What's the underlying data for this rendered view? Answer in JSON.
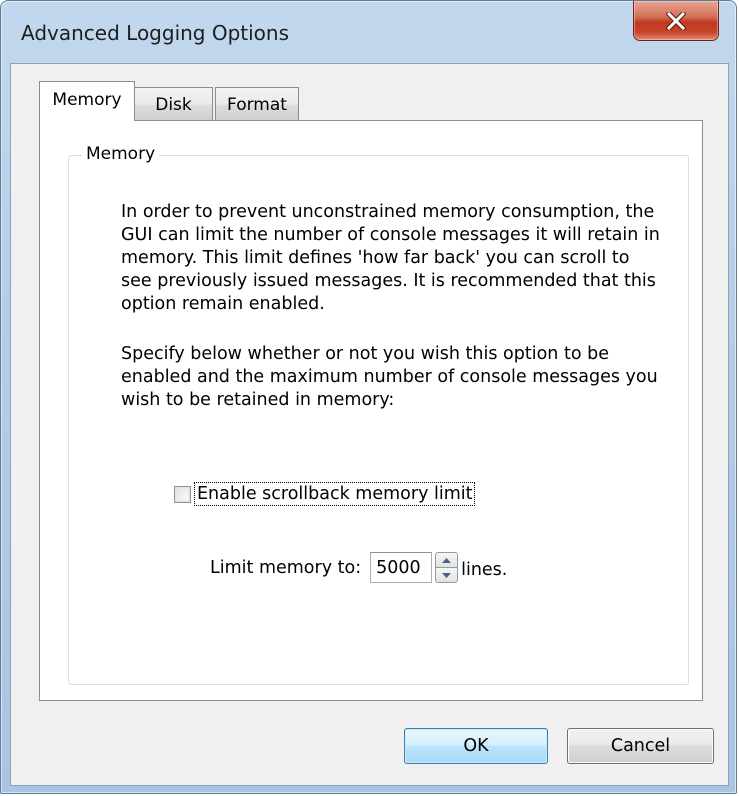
{
  "window": {
    "title": "Advanced Logging Options",
    "close_icon": "close-icon"
  },
  "tabs": [
    {
      "label": "Memory",
      "active": true
    },
    {
      "label": "Disk",
      "active": false
    },
    {
      "label": "Format",
      "active": false
    }
  ],
  "memory_group": {
    "legend": "Memory",
    "description_1": "In order to prevent unconstrained memory consumption, the GUI can limit the number of console messages it will retain in memory. This limit defines 'how far back' you can scroll to see previously issued messages. It is recommended that this option remain enabled.",
    "description_2": "Specify below whether or not you wish this option to be enabled and the maximum number of console messages you wish to be retained in memory:",
    "checkbox": {
      "label": "Enable scrollback memory limit",
      "checked": false
    },
    "limit": {
      "label": "Limit memory to:",
      "value": "5000",
      "suffix": "lines."
    }
  },
  "buttons": {
    "ok": "OK",
    "cancel": "Cancel"
  },
  "colors": {
    "close_button": "#c8462a",
    "ok_button_border": "#3c7fb1",
    "frame": "#b4cde8"
  }
}
